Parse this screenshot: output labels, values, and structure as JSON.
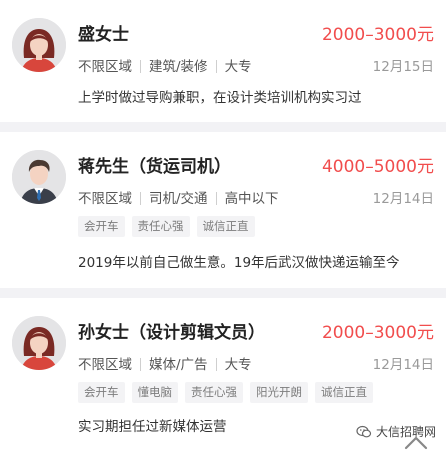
{
  "candidates": [
    {
      "name": "盛女士",
      "salary": "2000–3000元",
      "location": "不限区域",
      "category": "建筑/装修",
      "education": "大专",
      "date": "12月15日",
      "tags": [],
      "description": "上学时做过导购兼职，在设计类培训机构实习过",
      "avatar": "female-avatar-icon"
    },
    {
      "name": "蒋先生（货运司机）",
      "salary": "4000–5000元",
      "location": "不限区域",
      "category": "司机/交通",
      "education": "高中以下",
      "date": "12月14日",
      "tags": [
        "会开车",
        "责任心强",
        "诚信正直"
      ],
      "description": "2019年以前自己做生意。19年后武汉做快递运输至今",
      "avatar": "male-avatar-icon"
    },
    {
      "name": "孙女士（设计剪辑文员）",
      "salary": "2000–3000元",
      "location": "不限区域",
      "category": "媒体/广告",
      "education": "大专",
      "date": "12月14日",
      "tags": [
        "会开车",
        "懂电脑",
        "责任心强",
        "阳光开朗",
        "诚信正直"
      ],
      "description": "实习期担任过新媒体运营",
      "avatar": "female-avatar-icon"
    }
  ],
  "watermark": {
    "text": "大信招聘网"
  },
  "colors": {
    "salary": "#f14d4d",
    "background": "#f2f2f5",
    "tag_bg": "#f3f3f5"
  }
}
